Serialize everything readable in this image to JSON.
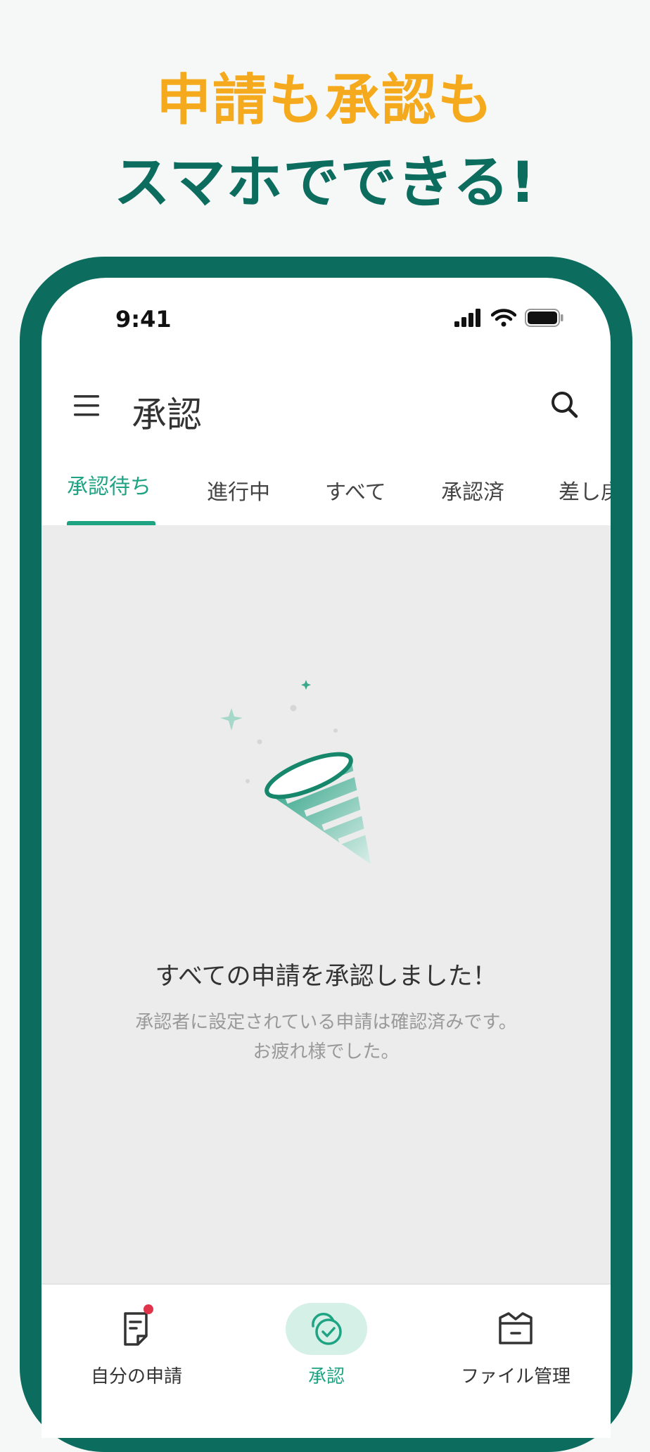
{
  "promo": {
    "line1": "申請も承認も",
    "line2": "スマホでできる!"
  },
  "status_bar": {
    "time": "9:41"
  },
  "app_bar": {
    "title": "承認"
  },
  "tabs": [
    {
      "label": "承認待ち",
      "active": true
    },
    {
      "label": "進行中",
      "active": false
    },
    {
      "label": "すべて",
      "active": false
    },
    {
      "label": "承認済",
      "active": false
    },
    {
      "label": "差し戻",
      "active": false
    }
  ],
  "empty_state": {
    "title": "すべての申請を承認しました！",
    "desc_line1": "承認者に設定されている申請は確認済みです。",
    "desc_line2": "お疲れ様でした。"
  },
  "bottom_nav": [
    {
      "label": "自分の申請",
      "icon": "document-icon",
      "active": false,
      "has_badge": true
    },
    {
      "label": "承認",
      "icon": "approval-chat-icon",
      "active": true,
      "has_badge": false
    },
    {
      "label": "ファイル管理",
      "icon": "file-box-icon",
      "active": false,
      "has_badge": false
    }
  ],
  "colors": {
    "accent_green": "#1ea383",
    "frame_green": "#0c6c5d",
    "headline_orange": "#f5a91c",
    "badge_red": "#e0344a"
  }
}
